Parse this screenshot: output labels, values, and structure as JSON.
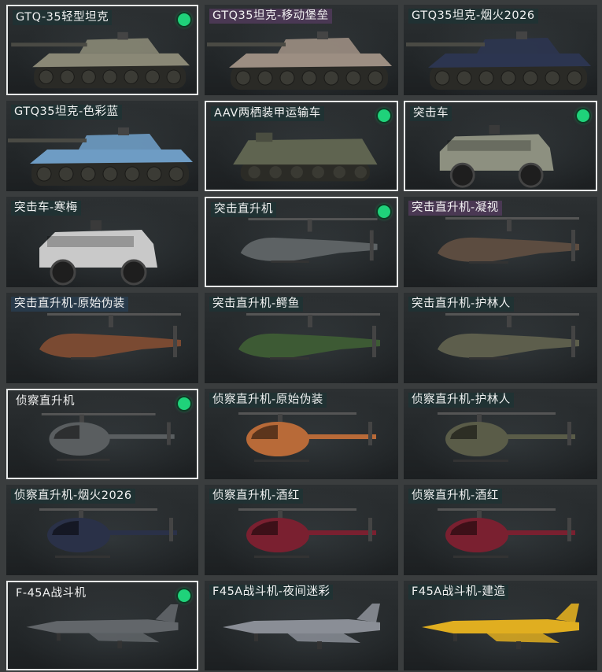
{
  "vehicles": [
    {
      "name": "GTQ-35轻型坦克",
      "equipped": true,
      "tag": "dark",
      "icon": "tank-icon",
      "color": "#8a8876"
    },
    {
      "name": "GTQ35坦克-移动堡垒",
      "equipped": false,
      "tag": "purple",
      "icon": "tank-icon",
      "color": "#9c8e82"
    },
    {
      "name": "GTQ35坦克-烟火2026",
      "equipped": false,
      "tag": "dark",
      "icon": "tank-icon",
      "color": "#2c3550"
    },
    {
      "name": "GTQ35坦克-色彩蓝",
      "equipped": false,
      "tag": "dark",
      "icon": "tank-icon",
      "color": "#6e9cc4"
    },
    {
      "name": "AAV两栖装甲运输车",
      "equipped": true,
      "tag": "dark",
      "icon": "apc-icon",
      "color": "#5f6450"
    },
    {
      "name": "突击车",
      "equipped": true,
      "tag": "dark",
      "icon": "assault-vehicle-icon",
      "color": "#8d9080"
    },
    {
      "name": "突击车-寒梅",
      "equipped": false,
      "tag": "dark",
      "icon": "assault-vehicle-icon",
      "color": "#c9c9c9"
    },
    {
      "name": "突击直升机",
      "equipped": true,
      "tag": "dark",
      "icon": "attack-helicopter-icon",
      "color": "#5d6264"
    },
    {
      "name": "突击直升机-凝视",
      "equipped": false,
      "tag": "purple",
      "icon": "attack-helicopter-icon",
      "color": "#5c4c40"
    },
    {
      "name": "突击直升机-原始伪装",
      "equipped": false,
      "tag": "blue",
      "icon": "attack-helicopter-icon",
      "color": "#7a4a32"
    },
    {
      "name": "突击直升机-鳄鱼",
      "equipped": false,
      "tag": "dark",
      "icon": "attack-helicopter-icon",
      "color": "#3d5a34"
    },
    {
      "name": "突击直升机-护林人",
      "equipped": false,
      "tag": "dark",
      "icon": "attack-helicopter-icon",
      "color": "#5d5e4c"
    },
    {
      "name": "侦察直升机",
      "equipped": true,
      "tag": "none",
      "icon": "scout-helicopter-icon",
      "color": "#5a5e60"
    },
    {
      "name": "侦察直升机-原始伪装",
      "equipped": false,
      "tag": "dark",
      "icon": "scout-helicopter-icon",
      "color": "#b86a38"
    },
    {
      "name": "侦察直升机-护林人",
      "equipped": false,
      "tag": "dark",
      "icon": "scout-helicopter-icon",
      "color": "#5a5c48"
    },
    {
      "name": "侦察直升机-烟火2026",
      "equipped": false,
      "tag": "dark",
      "icon": "scout-helicopter-icon",
      "color": "#2a3148"
    },
    {
      "name": "侦察直升机-酒红",
      "equipped": false,
      "tag": "dark",
      "icon": "scout-helicopter-icon",
      "color": "#7a2030"
    },
    {
      "name": "侦察直升机-酒红",
      "equipped": false,
      "tag": "dark",
      "icon": "scout-helicopter-icon",
      "color": "#7a2030"
    },
    {
      "name": "F-45A战斗机",
      "equipped": true,
      "tag": "none",
      "icon": "fighter-jet-icon",
      "color": "#62666a"
    },
    {
      "name": "F45A战斗机-夜间迷彩",
      "equipped": false,
      "tag": "dark",
      "icon": "fighter-jet-icon",
      "color": "#8a8e96"
    },
    {
      "name": "F45A战斗机-建造",
      "equipped": false,
      "tag": "dark",
      "icon": "fighter-jet-icon",
      "color": "#e0ae20"
    }
  ]
}
